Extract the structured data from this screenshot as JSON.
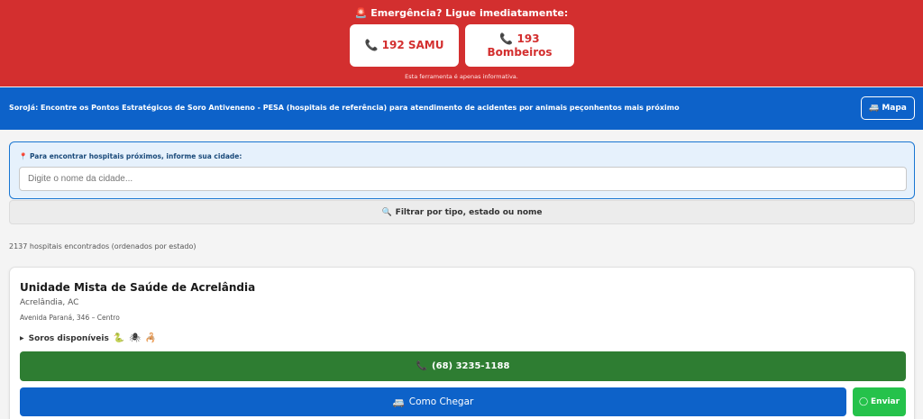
{
  "emergency": {
    "title": "🚨 Emergência? Ligue imediatamente:",
    "samu_label": "192 SAMU",
    "bombeiros_number": "193",
    "bombeiros_label": "Bombeiros",
    "note": "Esta ferramenta é apenas informativa."
  },
  "header": {
    "text": "SoroJá: Encontre os Pontos Estratégicos de Soro Antiveneno - PESA (hospitais de referência) para atendimento de acidentes por animais peçonhentos mais próximo",
    "map_label": "Mapa"
  },
  "search": {
    "label": "Para encontrar hospitais próximos, informe sua cidade:",
    "placeholder": "Digite o nome da cidade..."
  },
  "filter": {
    "label": "Filtrar por tipo, estado ou nome"
  },
  "results": {
    "count_text": "2137 hospitais encontrados (ordenados por estado)"
  },
  "hospital": {
    "name": "Unidade Mista de Saúde de Acrelândia",
    "city": "Acrelândia, AC",
    "address": "Avenida Paraná, 346 – Centro",
    "soros_label": "Soros disponíveis",
    "phone": "(68) 3235-1188",
    "route_label": "Como Chegar",
    "whatsapp_label": "Enviar"
  },
  "colors": {
    "emergency_red": "#d32f2f",
    "header_blue": "#0d62c9",
    "phone_green": "#2e7d32",
    "whatsapp_green": "#25c24b"
  },
  "icons": {
    "phone": "phone-icon",
    "map": "car-icon",
    "pin": "pin-icon",
    "search": "magnifier-icon",
    "snake": "snake-icon",
    "spider": "spider-icon",
    "scorpion": "scorpion-icon",
    "whatsapp": "whatsapp-icon"
  }
}
